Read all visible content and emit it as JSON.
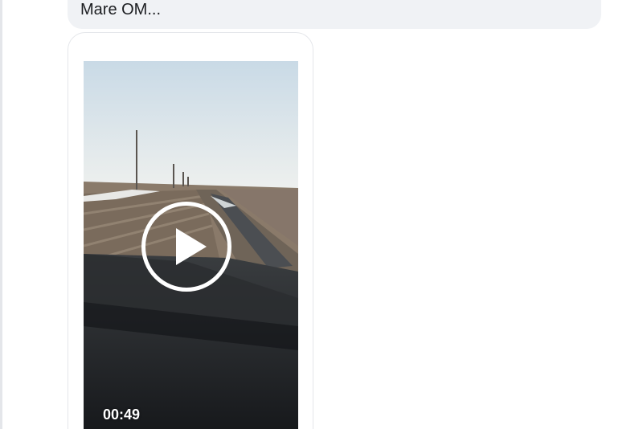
{
  "message": {
    "text": "Mare OM..."
  },
  "video": {
    "duration": "00:49",
    "play_icon": "play-icon"
  },
  "colors": {
    "bubble_bg": "#f0f2f5",
    "card_border": "#e4e6ea",
    "overlay_white": "#ffffff"
  }
}
